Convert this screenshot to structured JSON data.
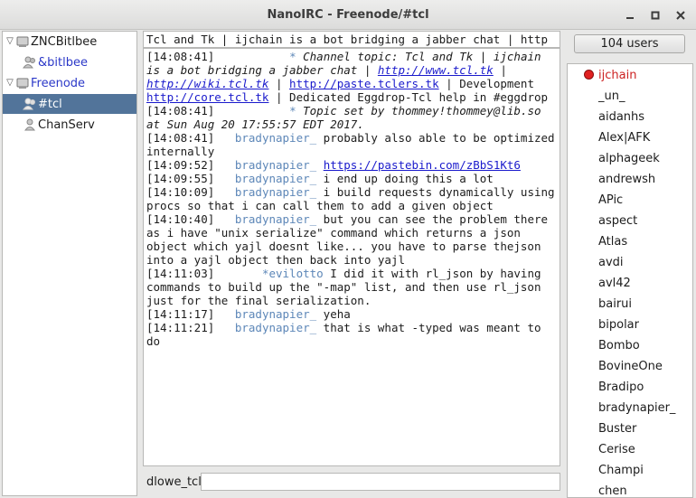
{
  "window": {
    "title": "NanoIRC - Freenode/#tcl",
    "min_icon": "minimize-icon",
    "max_icon": "maximize-icon",
    "close_icon": "close-icon"
  },
  "tree": [
    {
      "label": "ZNCBitlbee",
      "level": 0,
      "expanded": true,
      "icon": "server-icon"
    },
    {
      "label": "&bitlbee",
      "level": 1,
      "icon": "users-icon",
      "color": "#2b38c8"
    },
    {
      "label": "Freenode",
      "level": 0,
      "expanded": true,
      "icon": "server-icon",
      "color": "#2b38c8"
    },
    {
      "label": "#tcl",
      "level": 1,
      "icon": "users-icon",
      "selected": true
    },
    {
      "label": "ChanServ",
      "level": 1,
      "icon": "user-icon"
    }
  ],
  "topic": "Tcl and Tk | ijchain is a bot bridging a jabber chat | http",
  "messages": [
    {
      "ts": "[14:08:41]",
      "nick": "*",
      "italic": true,
      "parts": [
        {
          "t": " Channel topic: Tcl and Tk | ijchain is a bot bridging a jabber chat | "
        },
        {
          "t": "http://www.tcl.tk",
          "link": true
        },
        {
          "t": " | "
        },
        {
          "t": "http://wiki.tcl.tk",
          "link": true
        },
        {
          "t": " | "
        },
        {
          "t": "http://paste.tclers.tk",
          "link": true,
          "plain": true
        },
        {
          "t": " | Development ",
          "plain": true
        },
        {
          "t": "http://core.tcl.tk",
          "link": true,
          "plain": true
        },
        {
          "t": " | Dedicated Eggdrop-Tcl help in #eggdrop",
          "plain": true
        }
      ]
    },
    {
      "ts": "[14:08:41]",
      "nick": "*",
      "italic": true,
      "parts": [
        {
          "t": " Topic set by thommey!thommey@lib.so at Sun Aug 20 17:55:57 EDT 2017."
        }
      ]
    },
    {
      "ts": "[14:08:41]",
      "nick": "bradynapier_",
      "parts": [
        {
          "t": " probably also able to be optimized internally"
        }
      ]
    },
    {
      "ts": "[14:09:52]",
      "nick": "bradynapier_",
      "parts": [
        {
          "t": " "
        },
        {
          "t": "https://pastebin.com/zBbS1Kt6",
          "link": true
        }
      ]
    },
    {
      "ts": "[14:09:55]",
      "nick": "bradynapier_",
      "parts": [
        {
          "t": " i end up doing this a lot"
        }
      ]
    },
    {
      "ts": "[14:10:09]",
      "nick": "bradynapier_",
      "parts": [
        {
          "t": " i build requests dynamically using procs so that i can call them to add a given object"
        }
      ]
    },
    {
      "ts": "[14:10:40]",
      "nick": "bradynapier_",
      "parts": [
        {
          "t": " but you can see the problem there as i have \"unix serialize\" command which returns a json object which yajl doesnt like... you have to parse thejson into a yajl object then back into yajl"
        }
      ]
    },
    {
      "ts": "[14:11:03]",
      "nick": "*evilotto",
      "parts": [
        {
          "t": " I did it with rl_json by having commands to build up the \"-map\" list, and then use rl_json just for the final serialization."
        }
      ]
    },
    {
      "ts": "[14:11:17]",
      "nick": "bradynapier_",
      "parts": [
        {
          "t": " yeha"
        }
      ]
    },
    {
      "ts": "[14:11:21]",
      "nick": "bradynapier_",
      "parts": [
        {
          "t": " that is what -typed was meant to do"
        }
      ]
    }
  ],
  "input": {
    "nick": "dlowe_tcl",
    "value": ""
  },
  "users": {
    "count_label": "104 users",
    "list": [
      {
        "name": "ijchain",
        "op": true
      },
      {
        "name": "_un_"
      },
      {
        "name": "aidanhs"
      },
      {
        "name": "Alex|AFK"
      },
      {
        "name": "alphageek"
      },
      {
        "name": "andrewsh"
      },
      {
        "name": "APic"
      },
      {
        "name": "aspect"
      },
      {
        "name": "Atlas"
      },
      {
        "name": "avdi"
      },
      {
        "name": "avl42"
      },
      {
        "name": "bairui"
      },
      {
        "name": "bipolar"
      },
      {
        "name": "Bombo"
      },
      {
        "name": "BovineOne"
      },
      {
        "name": "Bradipo"
      },
      {
        "name": "bradynapier_"
      },
      {
        "name": "Buster"
      },
      {
        "name": "Cerise"
      },
      {
        "name": "Champi"
      },
      {
        "name": "chen"
      }
    ]
  },
  "colors": {
    "selection": "#52749a",
    "nick": "#5d87b8",
    "link": "#1a1acc",
    "op": "#cc2222"
  }
}
